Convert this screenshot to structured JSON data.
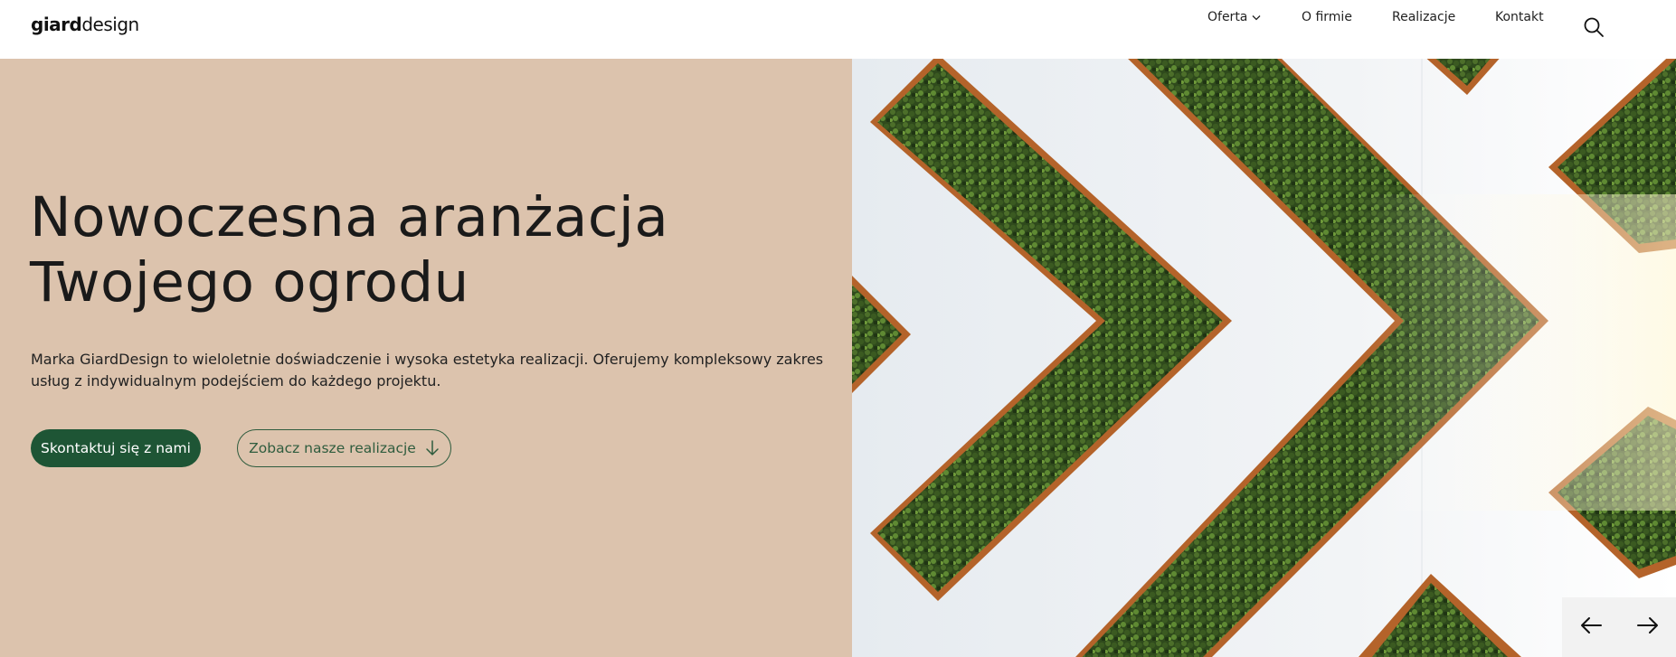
{
  "header": {
    "logo_bold": "giard",
    "logo_light": "design",
    "nav": {
      "oferta": "Oferta",
      "o_firmie": "O firmie",
      "realizacje": "Realizacje",
      "kontakt": "Kontakt"
    }
  },
  "hero": {
    "title_line1": "Nowoczesna aranżacja",
    "title_line2": "Twojego ogrodu",
    "description": "Marka GiardDesign to wieloletnie doświadczenie i wysoka estetyka realizacji. Oferujemy kompleksowy zakres usług z indywidualnym podejściem do każdego projektu.",
    "primary_button": "Skontaktuj się z nami",
    "secondary_button": "Zobacz nasze realizacje"
  },
  "colors": {
    "hero_background": "#dcc3ad",
    "primary_button": "#1e5535",
    "secondary_button_border": "#2f5c3e"
  },
  "icons": {
    "nav_dropdown": "chevron-down-icon",
    "search": "search-icon",
    "secondary_button": "arrow-down-icon",
    "slider_prev": "arrow-left-icon",
    "slider_next": "arrow-right-icon"
  }
}
